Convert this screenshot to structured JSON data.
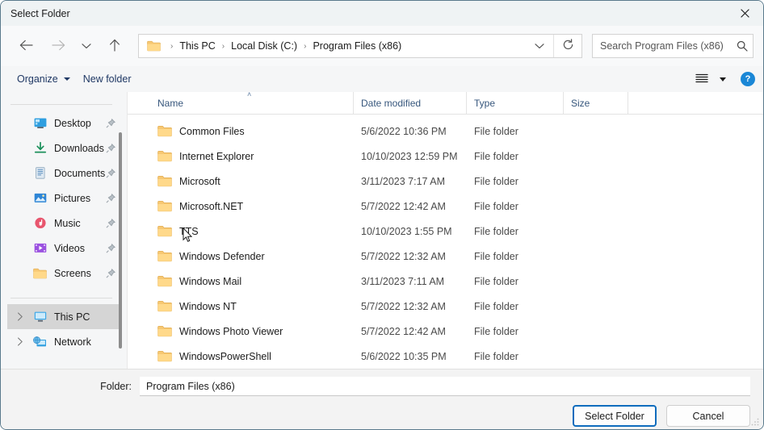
{
  "window": {
    "title": "Select Folder",
    "close_icon": "close-icon"
  },
  "nav": {
    "back_icon": "back-arrow-icon",
    "forward_icon": "forward-arrow-icon",
    "recent_icon": "chevron-down-icon",
    "up_icon": "up-arrow-icon",
    "refresh_icon": "refresh-icon",
    "dropdown_icon": "chevron-down-icon"
  },
  "address": {
    "folder_icon": "folder-icon",
    "separator": "›",
    "crumbs": [
      "This PC",
      "Local Disk (C:)",
      "Program Files (x86)"
    ]
  },
  "search": {
    "placeholder": "Search Program Files (x86)",
    "value": "",
    "icon": "search-icon"
  },
  "command_bar": {
    "organize_label": "Organize",
    "new_folder_label": "New folder",
    "view_icon": "list-view-icon",
    "view_caret_icon": "chevron-down-icon",
    "help_label": "?",
    "help_icon": "help-icon"
  },
  "sidebar": {
    "quick_access": [
      {
        "label": "Desktop",
        "icon": "desktop-icon",
        "pinned": true
      },
      {
        "label": "Downloads",
        "icon": "downloads-icon",
        "pinned": true
      },
      {
        "label": "Documents",
        "icon": "documents-icon",
        "pinned": true
      },
      {
        "label": "Pictures",
        "icon": "pictures-icon",
        "pinned": true
      },
      {
        "label": "Music",
        "icon": "music-icon",
        "pinned": true
      },
      {
        "label": "Videos",
        "icon": "videos-icon",
        "pinned": true
      },
      {
        "label": "Screens",
        "icon": "folder-icon",
        "pinned": true
      }
    ],
    "roots": [
      {
        "label": "This PC",
        "icon": "this-pc-icon",
        "selected": true,
        "expandable": true
      },
      {
        "label": "Network",
        "icon": "network-icon",
        "selected": false,
        "expandable": true
      }
    ],
    "pin_icon": "pin-icon",
    "expand_icon": "chevron-right-icon"
  },
  "file_list": {
    "columns": [
      "Name",
      "Date modified",
      "Type",
      "Size"
    ],
    "sort_column": "Name",
    "sort_direction": "ascending",
    "sort_caret": "˄",
    "rows": [
      {
        "name": "Common Files",
        "date": "5/6/2022 10:36 PM",
        "type": "File folder",
        "size": "",
        "icon": "folder-icon"
      },
      {
        "name": "Internet Explorer",
        "date": "10/10/2023 12:59 PM",
        "type": "File folder",
        "size": "",
        "icon": "folder-icon"
      },
      {
        "name": "Microsoft",
        "date": "3/11/2023 7:17 AM",
        "type": "File folder",
        "size": "",
        "icon": "folder-icon"
      },
      {
        "name": "Microsoft.NET",
        "date": "5/7/2022 12:42 AM",
        "type": "File folder",
        "size": "",
        "icon": "folder-icon"
      },
      {
        "name": "TTS",
        "date": "10/10/2023 1:55 PM",
        "type": "File folder",
        "size": "",
        "icon": "folder-icon"
      },
      {
        "name": "Windows Defender",
        "date": "5/7/2022 12:32 AM",
        "type": "File folder",
        "size": "",
        "icon": "folder-icon"
      },
      {
        "name": "Windows Mail",
        "date": "3/11/2023 7:11 AM",
        "type": "File folder",
        "size": "",
        "icon": "folder-icon"
      },
      {
        "name": "Windows NT",
        "date": "5/7/2022 12:32 AM",
        "type": "File folder",
        "size": "",
        "icon": "folder-icon"
      },
      {
        "name": "Windows Photo Viewer",
        "date": "5/7/2022 12:42 AM",
        "type": "File folder",
        "size": "",
        "icon": "folder-icon"
      },
      {
        "name": "WindowsPowerShell",
        "date": "5/6/2022 10:35 PM",
        "type": "File folder",
        "size": "",
        "icon": "folder-icon"
      }
    ]
  },
  "footer": {
    "folder_label": "Folder:",
    "folder_value": "Program Files (x86)",
    "select_button": "Select Folder",
    "cancel_button": "Cancel",
    "resize_grip_icon": "resize-grip-icon"
  },
  "cursor": {
    "icon": "mouse-pointer-icon"
  },
  "colors": {
    "accent": "#0f6cbd",
    "titlebar_bg": "#eff3f4",
    "sidebar_bg": "#f5f6f7",
    "selection_bg": "#d5d5d5",
    "header_text": "#36567c",
    "link_text": "#1f3864",
    "help_blue": "#1a87d6",
    "folder_yellow": "#ffcc66"
  }
}
